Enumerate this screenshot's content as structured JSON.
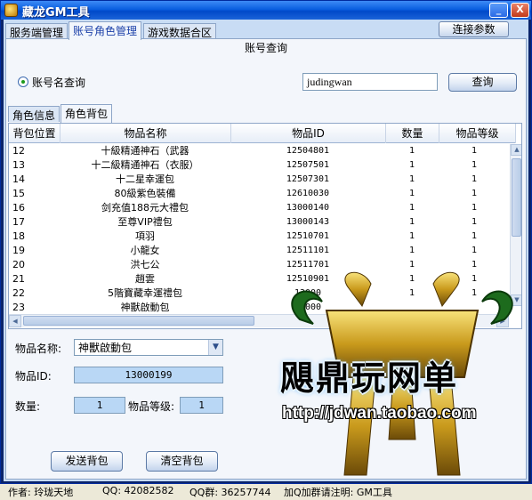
{
  "window": {
    "title": "藏龙GM工具",
    "minimize": "_",
    "close": "X"
  },
  "top_tabs": [
    "服务端管理",
    "账号角色管理",
    "游戏数据合区"
  ],
  "connect_button": "连接参数",
  "account_query": {
    "group_title": "账号查询",
    "radio_label": "账号名查询",
    "input_value": "judingwan",
    "query_button": "查询"
  },
  "sub_tabs": [
    "角色信息",
    "角色背包"
  ],
  "table": {
    "headers": [
      "背包位置",
      "物品名称",
      "物品ID",
      "数量",
      "物品等级"
    ],
    "rows": [
      [
        "12",
        "十級精通神石（武器",
        "12504801",
        "1",
        "1"
      ],
      [
        "13",
        "十二級精通神石（衣服）",
        "12507501",
        "1",
        "1"
      ],
      [
        "14",
        "十二星幸運包",
        "12507301",
        "1",
        "1"
      ],
      [
        "15",
        "80級紫色裝備",
        "12610030",
        "1",
        "1"
      ],
      [
        "16",
        "剑充值188元大禮包",
        "13000140",
        "1",
        "1"
      ],
      [
        "17",
        "至尊VIP禮包",
        "13000143",
        "1",
        "1"
      ],
      [
        "18",
        "項羽",
        "12510701",
        "1",
        "1"
      ],
      [
        "19",
        "小龍女",
        "12511101",
        "1",
        "1"
      ],
      [
        "20",
        "洪七公",
        "12511701",
        "1",
        "1"
      ],
      [
        "21",
        "趙雲",
        "12510901",
        "1",
        "1"
      ],
      [
        "22",
        "5階寶藏幸運禮包",
        "13000",
        "1",
        "1"
      ],
      [
        "23",
        "神獸啟動包",
        "13000",
        "",
        ""
      ]
    ]
  },
  "item_form": {
    "name_label": "物品名称:",
    "name_value": "神獸啟動包",
    "id_label": "物品ID:",
    "id_value": "13000199",
    "qty_label": "数量:",
    "qty_value": "1",
    "level_label": "物品等级:",
    "level_value": "1",
    "send_button": "发送背包",
    "clear_button": "清空背包"
  },
  "status_bar": {
    "author": "作者: 玲珑天地",
    "qq": "QQ: 42082582",
    "qq_group": "QQ群: 36257744",
    "note": "加Q加群请注明: GM工具"
  },
  "watermark": {
    "text": "飓鼎玩网单",
    "url": "http://jdwan.taobao.com"
  }
}
